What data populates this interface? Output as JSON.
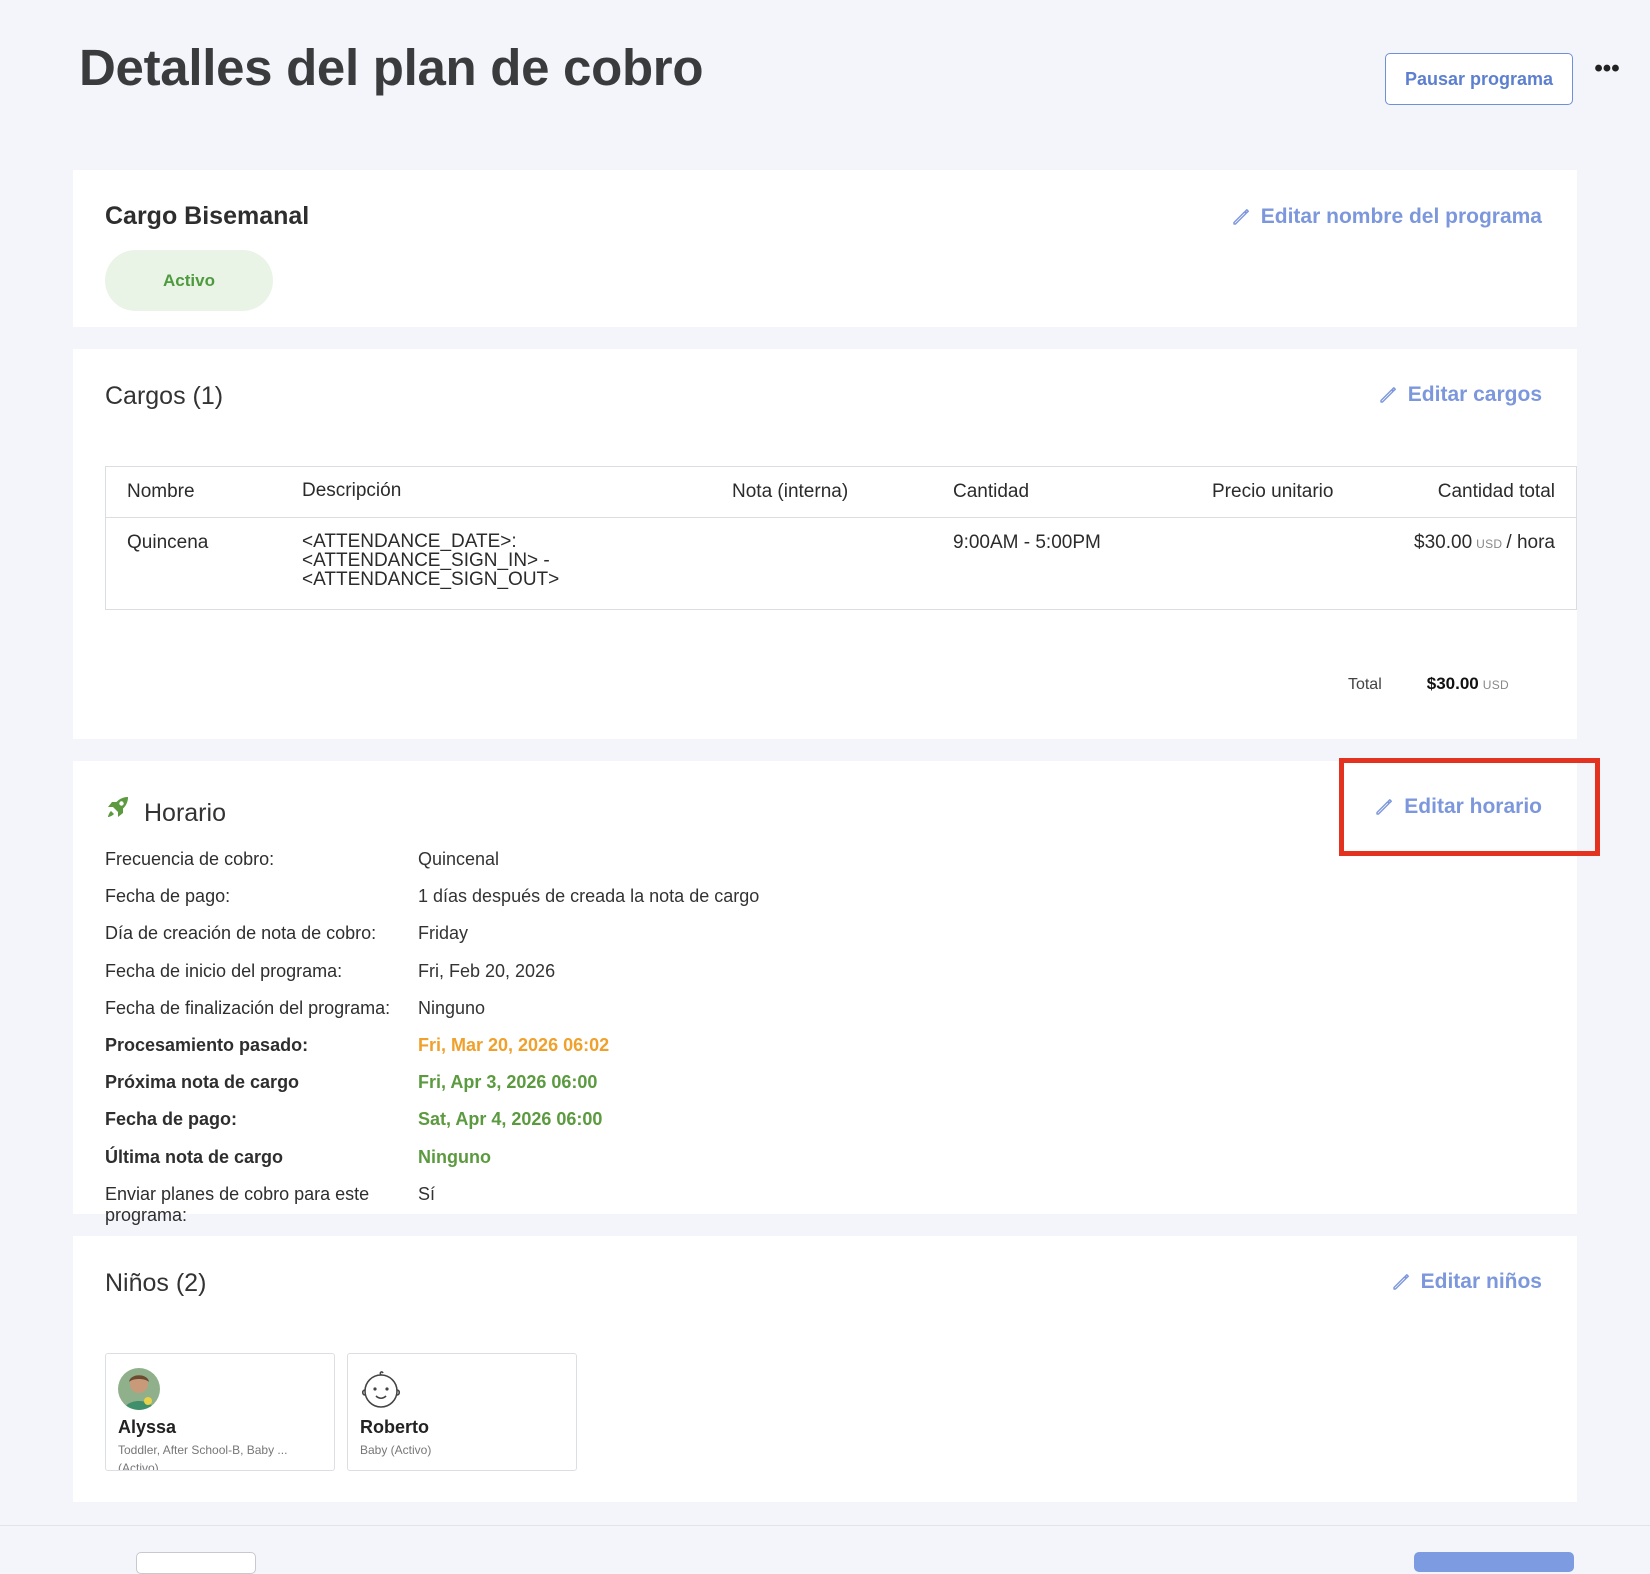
{
  "header": {
    "title": "Detalles del plan de cobro",
    "pause_label": "Pausar programa",
    "more_label": "•••"
  },
  "plan": {
    "name": "Cargo Bisemanal",
    "status": "Activo",
    "edit_name_label": "Editar nombre del programa"
  },
  "charges": {
    "title": "Cargos (1)",
    "edit_label": "Editar cargos",
    "columns": [
      "Nombre",
      "Descripción",
      "Nota (interna)",
      "Cantidad",
      "Precio unitario",
      "Cantidad total"
    ],
    "rows": [
      {
        "nombre": "Quincena",
        "descripcion": [
          "<ATTENDANCE_DATE>:",
          "<ATTENDANCE_SIGN_IN> -",
          "<ATTENDANCE_SIGN_OUT>"
        ],
        "nota": "",
        "cantidad": "9:00AM - 5:00PM",
        "precio_unitario": "",
        "total_amount": "$30.00",
        "total_currency": "USD",
        "total_unit": "/ hora"
      }
    ],
    "total_label": "Total",
    "total_amount": "$30.00",
    "total_currency": "USD"
  },
  "schedule": {
    "title": "Horario",
    "edit_label": "Editar horario",
    "rows": [
      {
        "label": "Frecuencia de cobro:",
        "value": "Quincenal"
      },
      {
        "label": "Fecha de pago:",
        "value": "1 días después de creada la nota de cargo"
      },
      {
        "label": "Día de creación de nota de cobro:",
        "value": "Friday"
      },
      {
        "label": "Fecha de inicio del programa:",
        "value": "Fri, Feb 20, 2026"
      },
      {
        "label": "Fecha de finalización del programa:",
        "value": "Ninguno"
      },
      {
        "label": "Procesamiento pasado:",
        "value": "Fri, Mar 20, 2026 06:02"
      },
      {
        "label": "Próxima nota de cargo",
        "value": "Fri, Apr 3, 2026 06:00"
      },
      {
        "label": "Fecha de pago:",
        "value": "Sat, Apr 4, 2026 06:00"
      },
      {
        "label": "Última nota de cargo",
        "value": "Ninguno"
      },
      {
        "label": "Enviar planes de cobro para este programa:",
        "value": "Sí"
      }
    ]
  },
  "children": {
    "title": "Niños (2)",
    "edit_label": "Editar niños",
    "items": [
      {
        "name": "Alyssa",
        "groups": "Toddler, After School-B, Baby ...",
        "status": "(Activo)"
      },
      {
        "name": "Roberto",
        "groups": "Baby (Activo)"
      }
    ]
  },
  "colors": {
    "accent": "#7c97dc",
    "active_green": "#5b9a3f",
    "past_orange": "#f0a02c",
    "highlight_red": "#e3321f"
  }
}
